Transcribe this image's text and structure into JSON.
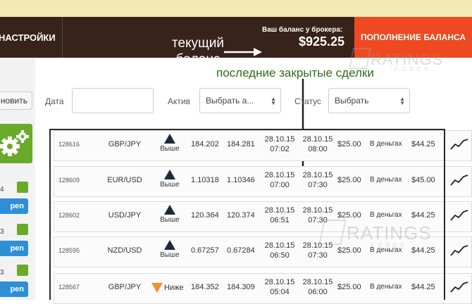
{
  "header": {
    "settings_label": "НАСТРОЙКИ",
    "balance_label": "Ваш баланс у брокера:",
    "balance_value": "$925.25",
    "deposit_label": "ПОПОЛНЕНИЕ БАЛАНСА"
  },
  "annotations": {
    "current_balance": "текущий баланс",
    "last_closed": "последние закрытые сделки"
  },
  "watermark": {
    "brand": "RATINGS",
    "sub": "FOREX"
  },
  "filters": {
    "refresh_label": "новить",
    "date_label": "Дата",
    "date_value": "",
    "asset_label": "Актив",
    "asset_value": "Выбрать а...",
    "status_label": "Статус",
    "status_value": "Выбрать"
  },
  "side_cards": [
    {
      "count": "4",
      "open_label": "pen"
    },
    {
      "count": "3",
      "open_label": "pen"
    },
    {
      "count": "3",
      "open_label": "pen"
    }
  ],
  "deals": [
    {
      "id": "128616",
      "pair": "GBP/JPY",
      "direction": "Выше",
      "dir": "up",
      "open": "184.202",
      "close": "184.281",
      "t1_date": "28.10.15",
      "t1_time": "07:02",
      "t2_date": "28.10.15",
      "t2_time": "08:00",
      "amount": "$25.00",
      "type": "В деньгах",
      "payout": "$44.25"
    },
    {
      "id": "128609",
      "pair": "EUR/USD",
      "direction": "Выше",
      "dir": "up",
      "open": "1.10318",
      "close": "1.10346",
      "t1_date": "28.10.15",
      "t1_time": "07:00",
      "t2_date": "28.10.15",
      "t2_time": "07:30",
      "amount": "$25.00",
      "type": "В деньгах",
      "payout": "$45.00"
    },
    {
      "id": "128602",
      "pair": "USD/JPY",
      "direction": "Выше",
      "dir": "up",
      "open": "120.364",
      "close": "120.374",
      "t1_date": "28.10.15",
      "t1_time": "06:51",
      "t2_date": "28.10.15",
      "t2_time": "07:30",
      "amount": "$25.00",
      "type": "В деньгах",
      "payout": "$44.25"
    },
    {
      "id": "128595",
      "pair": "NZD/USD",
      "direction": "Выше",
      "dir": "up",
      "open": "0.67257",
      "close": "0.67284",
      "t1_date": "28.10.15",
      "t1_time": "06:50",
      "t2_date": "28.10.15",
      "t2_time": "07:30",
      "amount": "$25.00",
      "type": "В деньгах",
      "payout": "$44.25"
    },
    {
      "id": "128567",
      "pair": "GBP/JPY",
      "direction": "Ниже",
      "dir": "down",
      "open": "184.352",
      "close": "184.309",
      "t1_date": "28.10.15",
      "t1_time": "05:04",
      "t2_date": "28.10.15",
      "t2_time": "06:00",
      "amount": "$25.00",
      "type": "В деньгах",
      "payout": "$44.25"
    }
  ]
}
